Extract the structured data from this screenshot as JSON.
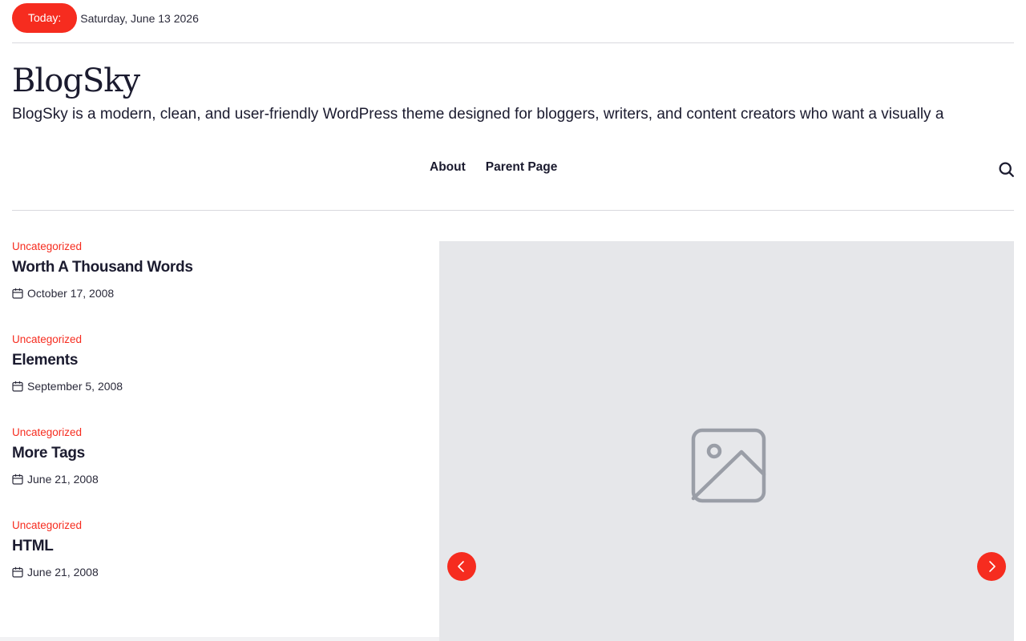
{
  "topbar": {
    "today_label": "Today:",
    "date": "Saturday, June 13 2026"
  },
  "site": {
    "title": "BlogSky",
    "description": "BlogSky is a modern, clean, and user-friendly WordPress theme designed for bloggers, writers, and content creators who want a visually a"
  },
  "nav": {
    "items": [
      {
        "label": "About"
      },
      {
        "label": "Parent Page"
      }
    ]
  },
  "posts": [
    {
      "category": "Uncategorized",
      "title": "Worth A Thousand Words",
      "date": "October 17, 2008"
    },
    {
      "category": "Uncategorized",
      "title": "Elements",
      "date": "September 5, 2008"
    },
    {
      "category": "Uncategorized",
      "title": "More Tags",
      "date": "June 21, 2008"
    },
    {
      "category": "Uncategorized",
      "title": "HTML",
      "date": "June 21, 2008"
    }
  ],
  "icons": {
    "search": "search-icon",
    "calendar": "calendar-icon",
    "image_placeholder": "image-icon",
    "prev": "chevron-left-icon",
    "next": "chevron-right-icon"
  },
  "colors": {
    "accent": "#f62c1f",
    "text": "#1b1b2f",
    "slider_bg": "#e6e7ea",
    "divider": "#d9d9de"
  }
}
